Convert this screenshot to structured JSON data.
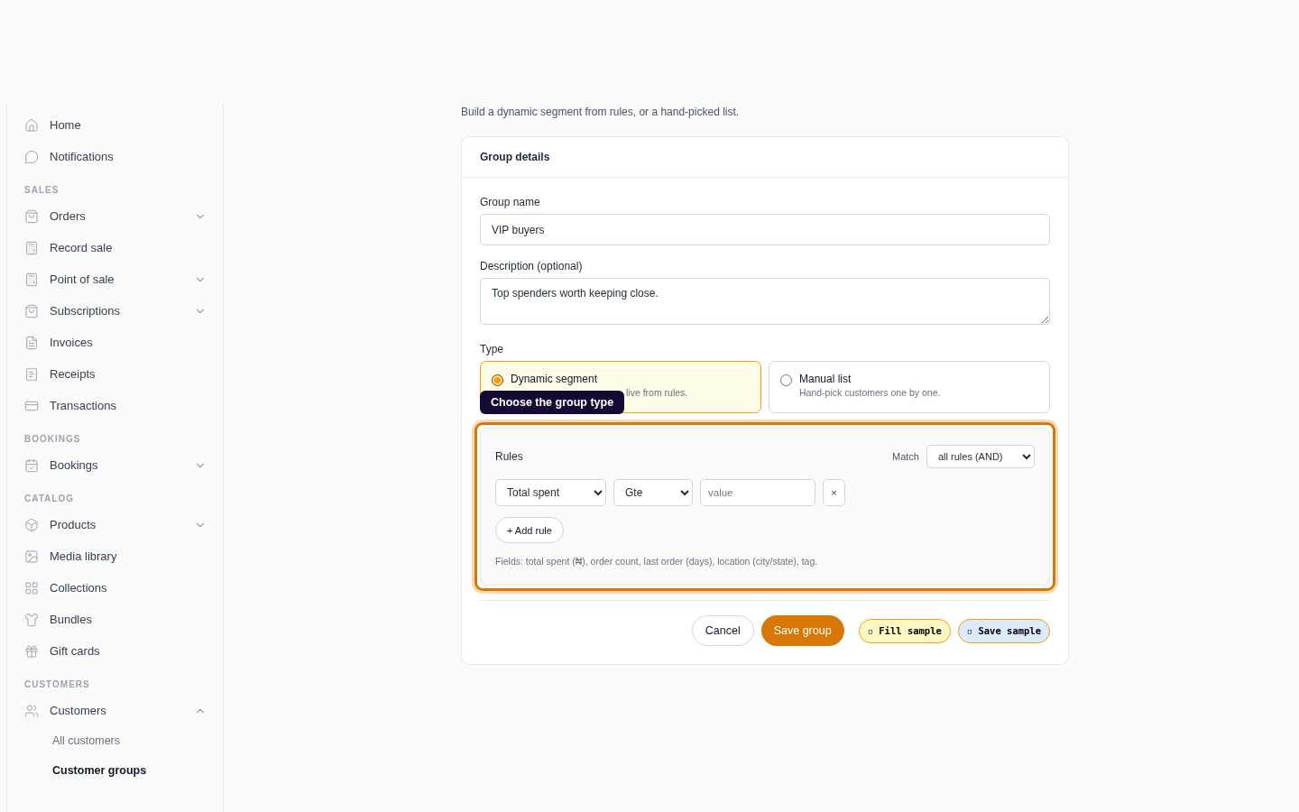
{
  "sidebar": {
    "items": [
      {
        "kind": "link",
        "label": "Home"
      },
      {
        "kind": "link",
        "label": "Notifications"
      },
      {
        "kind": "heading",
        "label": "SALES"
      },
      {
        "kind": "group",
        "label": "Orders",
        "expanded": false
      },
      {
        "kind": "link",
        "label": "Record sale"
      },
      {
        "kind": "group",
        "label": "Point of sale",
        "expanded": false
      },
      {
        "kind": "group",
        "label": "Subscriptions",
        "expanded": false
      },
      {
        "kind": "link",
        "label": "Invoices"
      },
      {
        "kind": "link",
        "label": "Receipts"
      },
      {
        "kind": "link",
        "label": "Transactions"
      },
      {
        "kind": "heading",
        "label": "BOOKINGS"
      },
      {
        "kind": "group",
        "label": "Bookings",
        "expanded": false
      },
      {
        "kind": "heading",
        "label": "CATALOG"
      },
      {
        "kind": "group",
        "label": "Products",
        "expanded": false
      },
      {
        "kind": "link",
        "label": "Media library"
      },
      {
        "kind": "link",
        "label": "Collections"
      },
      {
        "kind": "link",
        "label": "Bundles"
      },
      {
        "kind": "link",
        "label": "Gift cards"
      },
      {
        "kind": "heading",
        "label": "CUSTOMERS"
      },
      {
        "kind": "group",
        "label": "Customers",
        "expanded": true
      },
      {
        "kind": "sub",
        "label": "All customers",
        "selected": false
      },
      {
        "kind": "sub",
        "label": "Customer groups",
        "selected": true
      }
    ]
  },
  "intro": "Build a dynamic segment from rules, or a hand-picked list.",
  "card": {
    "title": "Group details",
    "name_label": "Group name",
    "name_value": "VIP buyers",
    "desc_label": "Description (optional)",
    "desc_value": "Top spenders worth keeping close.",
    "type_label": "Type",
    "types": [
      {
        "title": "Dynamic segment",
        "hint": "live from rules.",
        "selected": true
      },
      {
        "title": "Manual list",
        "hint": "Hand-pick customers one by one.",
        "selected": false
      }
    ],
    "tooltip": "Choose the group type",
    "rules": {
      "title": "Match",
      "heading": "Rules",
      "match": "all rules (AND)",
      "highlighted": true,
      "rows": [
        {
          "field": "Total spent",
          "op": "Gte",
          "placeholder": "value",
          "remove": "×"
        }
      ],
      "add": "+ Add rule",
      "help": "Fields: total spent (₦), order count, last order (days), location (city/state), tag."
    },
    "actions": [
      {
        "kind": "outline",
        "label": "Cancel"
      },
      {
        "kind": "primary",
        "label": "Save group"
      },
      {
        "kind": "yellow",
        "label": "▫ Fill sample"
      },
      {
        "kind": "blue",
        "label": "▫ Save sample"
      }
    ]
  }
}
